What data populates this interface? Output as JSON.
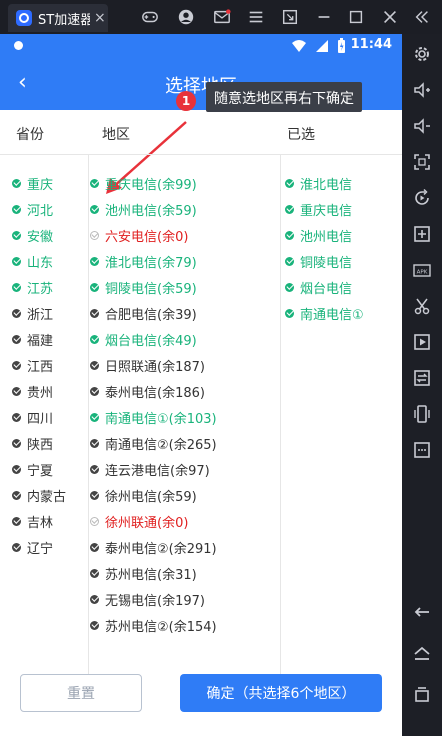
{
  "window": {
    "tab_title": "ST加速器",
    "close_tab": "×",
    "icons": [
      "gamepad-icon",
      "account-icon",
      "mail-icon",
      "menu-icon",
      "fullscreen-icon",
      "minimize-icon",
      "maximize-icon",
      "close-icon",
      "collapse-icon"
    ]
  },
  "status_bar": {
    "time": "11:44"
  },
  "nav": {
    "back": "‹",
    "title": "选择地区"
  },
  "tip": {
    "badge": "1",
    "text": "随意选地区再右下确定"
  },
  "headers": {
    "province": "省份",
    "region": "地区",
    "selected": "已选"
  },
  "provinces": [
    {
      "label": "重庆",
      "state": "on"
    },
    {
      "label": "河北",
      "state": "on"
    },
    {
      "label": "安徽",
      "state": "on"
    },
    {
      "label": "山东",
      "state": "on"
    },
    {
      "label": "江苏",
      "state": "on"
    },
    {
      "label": "浙江",
      "state": "off"
    },
    {
      "label": "福建",
      "state": "off"
    },
    {
      "label": "江西",
      "state": "off"
    },
    {
      "label": "贵州",
      "state": "off"
    },
    {
      "label": "四川",
      "state": "off"
    },
    {
      "label": "陕西",
      "state": "off"
    },
    {
      "label": "宁夏",
      "state": "off"
    },
    {
      "label": "内蒙古",
      "state": "off"
    },
    {
      "label": "吉林",
      "state": "off"
    },
    {
      "label": "辽宁",
      "state": "off"
    }
  ],
  "regions": [
    {
      "label": "重庆电信(余99)",
      "state": "on"
    },
    {
      "label": "池州电信(余59)",
      "state": "on"
    },
    {
      "label": "六安电信(余0)",
      "state": "dis"
    },
    {
      "label": "淮北电信(余79)",
      "state": "on"
    },
    {
      "label": "铜陵电信(余59)",
      "state": "on"
    },
    {
      "label": "合肥电信(余39)",
      "state": "off"
    },
    {
      "label": "烟台电信(余49)",
      "state": "on"
    },
    {
      "label": "日照联通(余187)",
      "state": "off"
    },
    {
      "label": "泰州电信(余186)",
      "state": "off"
    },
    {
      "label": "南通电信①(余103)",
      "state": "on"
    },
    {
      "label": "南通电信②(余265)",
      "state": "off"
    },
    {
      "label": "连云港电信(余97)",
      "state": "off"
    },
    {
      "label": "徐州电信(余59)",
      "state": "off"
    },
    {
      "label": "徐州联通(余0)",
      "state": "dis"
    },
    {
      "label": "泰州电信②(余291)",
      "state": "off"
    },
    {
      "label": "苏州电信(余31)",
      "state": "off"
    },
    {
      "label": "无锡电信(余197)",
      "state": "off"
    },
    {
      "label": "苏州电信②(余154)",
      "state": "off"
    }
  ],
  "selected": [
    {
      "label": "淮北电信",
      "state": "on"
    },
    {
      "label": "重庆电信",
      "state": "on"
    },
    {
      "label": "池州电信",
      "state": "on"
    },
    {
      "label": "铜陵电信",
      "state": "on"
    },
    {
      "label": "烟台电信",
      "state": "on"
    },
    {
      "label": "南通电信①",
      "state": "on"
    }
  ],
  "buttons": {
    "reset": "重置",
    "confirm": "确定（共选择6个地区）"
  },
  "colors": {
    "accent": "#2f7cf6",
    "checked": "#19b37b",
    "unavailable": "#e02020"
  },
  "sidebar_icons": [
    "settings-icon",
    "volume-up-icon",
    "volume-down-icon",
    "screenshot-icon",
    "rotate-icon",
    "add-app-icon",
    "apk-icon",
    "scissors-icon",
    "video-icon",
    "sync-icon",
    "shake-icon",
    "more-icon",
    "back-icon",
    "home-icon",
    "recent-apps-icon"
  ]
}
